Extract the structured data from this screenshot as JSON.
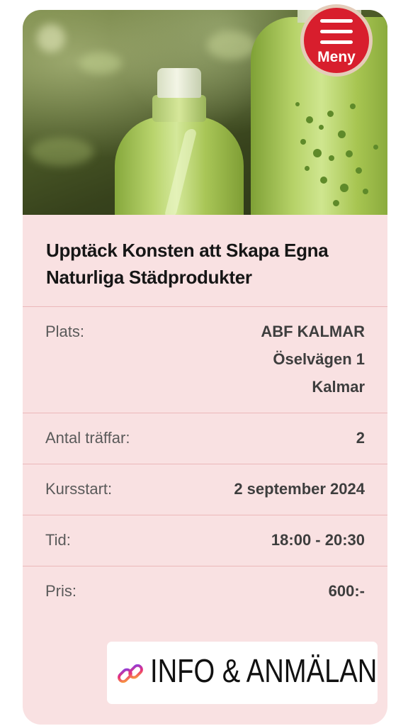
{
  "menu": {
    "label": "Meny"
  },
  "course": {
    "title_line1": "Upptäck Konsten att Skapa Egna",
    "title_line2": "Naturliga Städprodukter"
  },
  "details": {
    "location": {
      "label": "Plats:",
      "venue": "ABF KALMAR",
      "street": "Öselvägen 1",
      "city": "Kalmar"
    },
    "sessions": {
      "label": "Antal träffar:",
      "value": "2"
    },
    "start": {
      "label": "Kursstart:",
      "value": "2 september 2024"
    },
    "time": {
      "label": "Tid:",
      "value": "18:00 - 20:30"
    },
    "price": {
      "label": "Pris:",
      "value": "600:-"
    }
  },
  "cta": {
    "label": "INFO & ANMÄLAN",
    "icon": "link-icon"
  },
  "colors": {
    "card_background": "#f9e1e2",
    "divider": "#ecb8ba",
    "menu_button": "#d81e2d"
  }
}
